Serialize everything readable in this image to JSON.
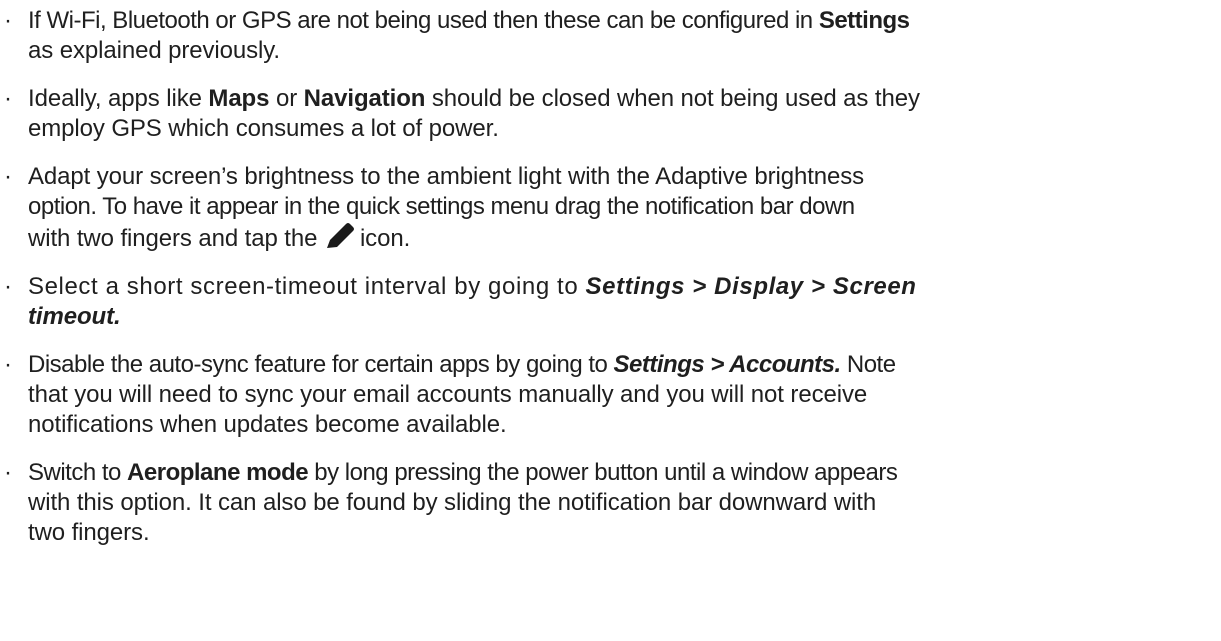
{
  "bullet_glyph": "·",
  "icons": {
    "edit": "pencil-icon"
  },
  "tips": [
    {
      "lines": [
        {
          "before": "If Wi-Fi, Bluetooth or GPS are not being used then these can be configured in ",
          "bold": "Settings"
        },
        {
          "text": "as explained previously."
        }
      ]
    },
    {
      "lines": [
        {
          "a": "Ideally, apps like ",
          "bold1": "Maps",
          "b": " or ",
          "bold2": "Navigation",
          "c": " should be closed when not being used as they"
        },
        {
          "text": "employ GPS which consumes a lot of power."
        }
      ]
    },
    {
      "lines": [
        {
          "text": "Adapt your screen’s brightness to the ambient light with the Adaptive brightness"
        },
        {
          "text": "option. To have it appear in the quick settings menu drag the notification bar down"
        },
        {
          "before": "with two fingers and tap the ",
          "after": "icon."
        }
      ]
    },
    {
      "lines": [
        {
          "before": "Select a short screen-timeout interval by going to ",
          "path": "Settings > Display > Screen"
        },
        {
          "path": "timeout."
        }
      ]
    },
    {
      "lines": [
        {
          "before": "Disable the auto-sync feature for certain apps by going to ",
          "path": "Settings > Accounts.",
          "after": " Note"
        },
        {
          "text": "that you will need to sync your email accounts manually and you will not receive"
        },
        {
          "text": "notifications when updates become available."
        }
      ]
    },
    {
      "lines": [
        {
          "before": "Switch to ",
          "bold": "Aeroplane mode",
          "after": " by long pressing the power button until a window appears"
        },
        {
          "text": "with this option. It can also be found by sliding the notification bar downward with"
        },
        {
          "text": "two fingers."
        }
      ]
    }
  ]
}
